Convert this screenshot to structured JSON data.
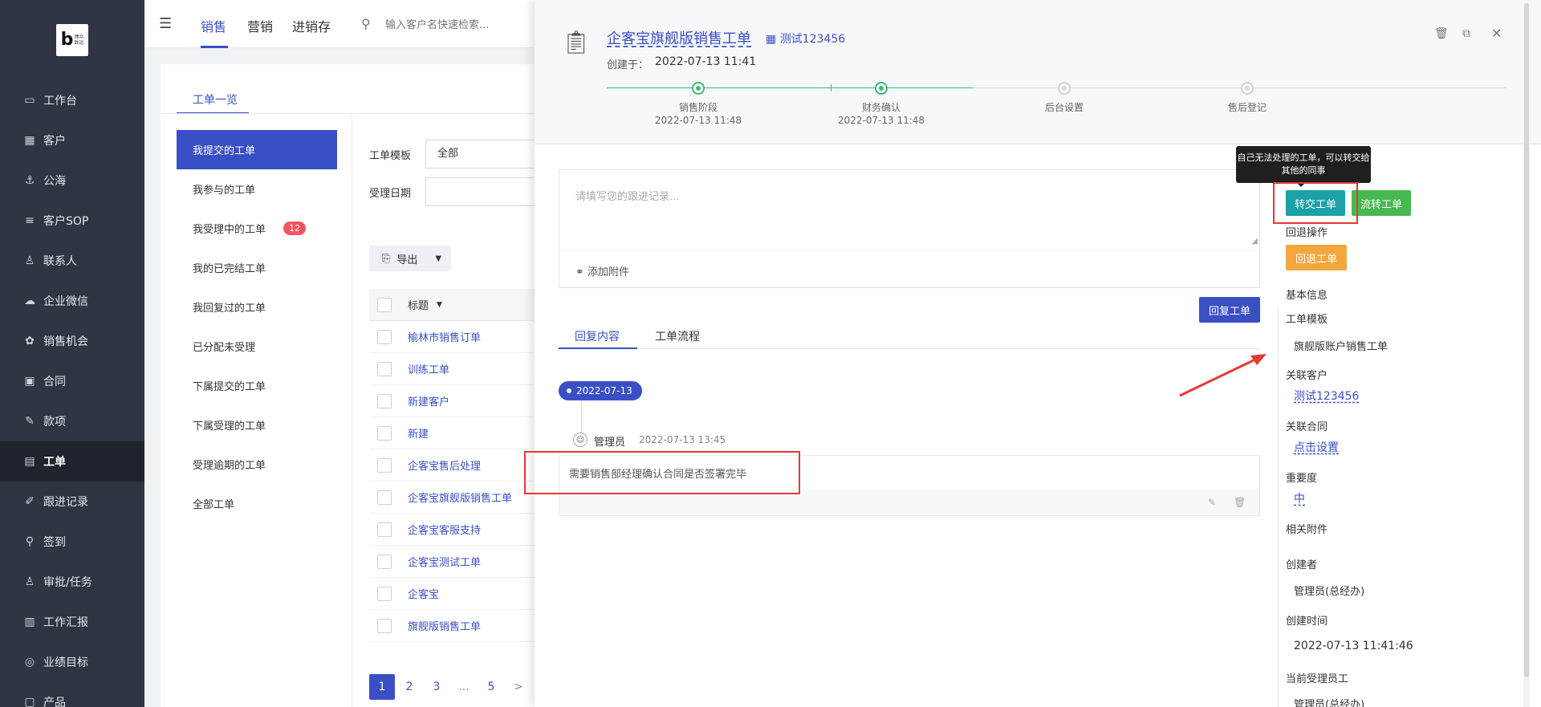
{
  "logo": {
    "brand_text": "博众\n致远"
  },
  "sidebar": {
    "items": [
      {
        "label": "工作台",
        "icon": "dashboard-icon",
        "glyph": "▭"
      },
      {
        "label": "客户",
        "icon": "building-icon",
        "glyph": "▦"
      },
      {
        "label": "公海",
        "icon": "ship-icon",
        "glyph": "⚓"
      },
      {
        "label": "客户SOP",
        "icon": "sop-icon",
        "glyph": "≡"
      },
      {
        "label": "联系人",
        "icon": "contact-icon",
        "glyph": "♙"
      },
      {
        "label": "企业微信",
        "icon": "wechat-icon",
        "glyph": "☁"
      },
      {
        "label": "销售机会",
        "icon": "money-bag-icon",
        "glyph": "✿"
      },
      {
        "label": "合同",
        "icon": "contract-icon",
        "glyph": "▣"
      },
      {
        "label": "款项",
        "icon": "payment-icon",
        "glyph": "✎"
      },
      {
        "label": "工单",
        "icon": "ticket-icon",
        "glyph": "▤",
        "active": true
      },
      {
        "label": "跟进记录",
        "icon": "edit-icon",
        "glyph": "✐"
      },
      {
        "label": "签到",
        "icon": "location-icon",
        "glyph": "⚲"
      },
      {
        "label": "审批/任务",
        "icon": "approval-icon",
        "glyph": "♙"
      },
      {
        "label": "工作汇报",
        "icon": "report-icon",
        "glyph": "▥"
      },
      {
        "label": "业绩目标",
        "icon": "target-icon",
        "glyph": "◎"
      },
      {
        "label": "产品",
        "icon": "product-icon",
        "glyph": "▢"
      }
    ]
  },
  "topbar": {
    "tabs": [
      "销售",
      "营销",
      "进销存"
    ],
    "search_placeholder": "输入客户名快速检索..."
  },
  "main": {
    "tab": "工单一览",
    "side_menu": [
      {
        "label": "我提交的工单",
        "active": true
      },
      {
        "label": "我参与的工单"
      },
      {
        "label": "我受理中的工单",
        "badge": "12"
      },
      {
        "label": "我的已完结工单"
      },
      {
        "label": "我回复过的工单"
      },
      {
        "label": "已分配未受理"
      },
      {
        "label": "下属提交的工单"
      },
      {
        "label": "下属受理的工单"
      },
      {
        "label": "受理逾期的工单"
      },
      {
        "label": "全部工单"
      }
    ],
    "filters": {
      "template_label": "工单模板",
      "template_value": "全部",
      "date_label": "受理日期"
    },
    "export_label": "导出",
    "table": {
      "header_title": "标题",
      "rows": [
        "榆林市销售订单",
        "训练工单",
        "新建客户",
        "新建",
        "企客宝售后处理",
        "企客宝旗舰版销售工单",
        "企客宝客服支持",
        "企客宝测试工单",
        "企客宝",
        "旗舰版销售工单"
      ]
    },
    "pagination": [
      "1",
      "2",
      "3",
      "...",
      "5",
      ">"
    ]
  },
  "drawer": {
    "title": "企客宝旗舰版销售工单",
    "customer": "测试123456",
    "created_label": "创建于：",
    "created_value": "2022-07-13 11:41",
    "steps": [
      {
        "label": "销售阶段",
        "time": "2022-07-13 11:48",
        "done": true
      },
      {
        "label": "财务确认",
        "time": "2022-07-13 11:48",
        "done": true
      },
      {
        "label": "后台设置",
        "time": "",
        "done": false
      },
      {
        "label": "售后登记",
        "time": "",
        "done": false
      }
    ],
    "note_placeholder": "请填写您的跟进记录...",
    "attach_label": "添加附件",
    "reply_button": "回复工单",
    "tabs": [
      "回复内容",
      "工单流程"
    ],
    "timeline_date": "2022-07-13",
    "author": "管理员",
    "reply_time": "2022-07-13 13:45",
    "reply_text": "需要销售部经理确认合同是否签署完毕"
  },
  "info": {
    "tooltip": "自己无法处理的工单，可以转交给其他的同事",
    "transfer_button": "转交工单",
    "flow_button": "流转工单",
    "rollback_label": "回退操作",
    "rollback_button": "回退工单",
    "basic_info": "基本信息",
    "template_label": "工单模板",
    "template_value": "旗舰版账户销售工单",
    "customer_label": "关联客户",
    "customer_value": "测试123456",
    "contract_label": "关联合同",
    "contract_value": "点击设置",
    "priority_label": "重要度",
    "priority_value": "中",
    "attachments_label": "相关附件",
    "creator_label": "创建者",
    "creator_value": "管理员(总经办)",
    "created_time_label": "创建时间",
    "created_time_value": "2022-07-13 11:41:46",
    "handler_label": "当前受理员工",
    "handler_value": "管理员(总经办)"
  },
  "colors": {
    "primary": "#3b4fc4",
    "teal_button": "#1ba1a6",
    "green_button": "#47b94f",
    "orange_button": "#f2a73d",
    "annotation_red": "#e53935"
  }
}
